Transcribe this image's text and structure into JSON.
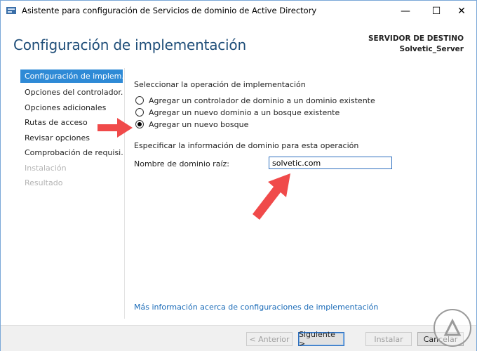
{
  "window": {
    "title": "Asistente para configuración de Servicios de dominio de Active Directory",
    "controls": {
      "minimize": "—",
      "maximize": "☐",
      "close": "✕"
    }
  },
  "header": {
    "page_title": "Configuración de implementación",
    "server_label": "SERVIDOR DE DESTINO",
    "server_name": "Solvetic_Server"
  },
  "sidebar": {
    "items": [
      {
        "label": "Configuración de implem...",
        "state": "active"
      },
      {
        "label": "Opciones del controlador...",
        "state": "normal"
      },
      {
        "label": "Opciones adicionales",
        "state": "normal"
      },
      {
        "label": "Rutas de acceso",
        "state": "normal"
      },
      {
        "label": "Revisar opciones",
        "state": "normal"
      },
      {
        "label": "Comprobación de requisi...",
        "state": "normal"
      },
      {
        "label": "Instalación",
        "state": "disabled"
      },
      {
        "label": "Resultado",
        "state": "disabled"
      }
    ]
  },
  "main": {
    "operation_heading": "Seleccionar la operación de implementación",
    "options": [
      {
        "label": "Agregar un controlador de dominio a un dominio existente",
        "checked": false
      },
      {
        "label": "Agregar un nuevo dominio a un bosque existente",
        "checked": false
      },
      {
        "label": "Agregar un nuevo bosque",
        "checked": true
      }
    ],
    "domain_heading": "Especificar la información de dominio para esta operación",
    "root_domain_label": "Nombre de dominio raíz:",
    "root_domain_value": "solvetic.com",
    "more_info_link": "Más información acerca de configuraciones de implementación"
  },
  "footer": {
    "back": "< Anterior",
    "next": "Siguiente >",
    "install": "Instalar",
    "cancel": "Cancelar"
  },
  "colors": {
    "accent": "#2e8ad6",
    "title_blue": "#1f4e79",
    "link": "#1a6bb8",
    "annotation_arrow": "#f04a4a"
  }
}
